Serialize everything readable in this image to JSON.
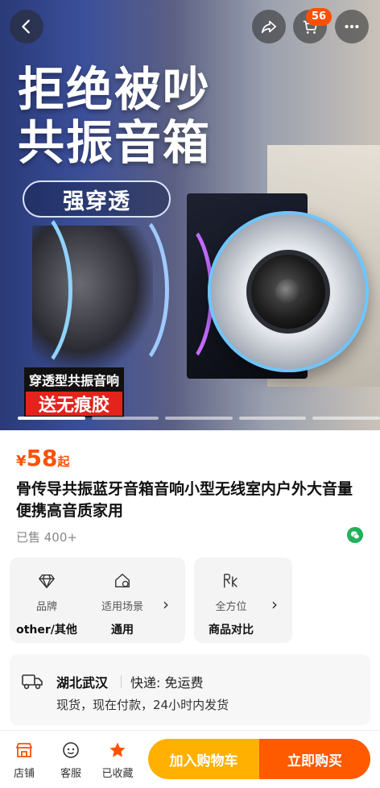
{
  "hero": {
    "headline_line1": "拒绝被吵",
    "headline_line2": "共振音箱",
    "pill_text": "强穿透",
    "badge_dark": "穿透型共振音响",
    "badge_red": "送无痕胶"
  },
  "nav": {
    "cart_count": "56"
  },
  "product": {
    "price_currency": "¥",
    "price": "58",
    "price_suffix": "起",
    "title": "骨传导共振蓝牙音箱音响小型无线室内户外大音量便携高音质家用",
    "sold": "已售 400+"
  },
  "attributes": {
    "brand_label": "品牌",
    "brand_value": "other/其他",
    "scene_label": "适用场景",
    "scene_value": "通用",
    "compare_label": "全方位",
    "compare_value": "商品对比"
  },
  "shipping": {
    "location": "湖北武汉",
    "fee": "快递: 免运费",
    "note": "现货，现在付款，24小时内发货"
  },
  "bottom": {
    "shop": "店铺",
    "service": "客服",
    "favorited": "已收藏",
    "add_to_cart": "加入购物车",
    "buy_now": "立即购买"
  },
  "colors": {
    "accent": "#ff5000",
    "cart_button": "#ffb000",
    "buy_button": "#ff5a00",
    "fav_star": "#ff5000"
  },
  "icons": [
    "back-icon",
    "share-icon",
    "cart-icon",
    "more-icon",
    "diamond-icon",
    "home-check-icon",
    "rk-icon",
    "truck-icon",
    "store-icon",
    "service-icon",
    "star-icon",
    "wechat-icon"
  ]
}
